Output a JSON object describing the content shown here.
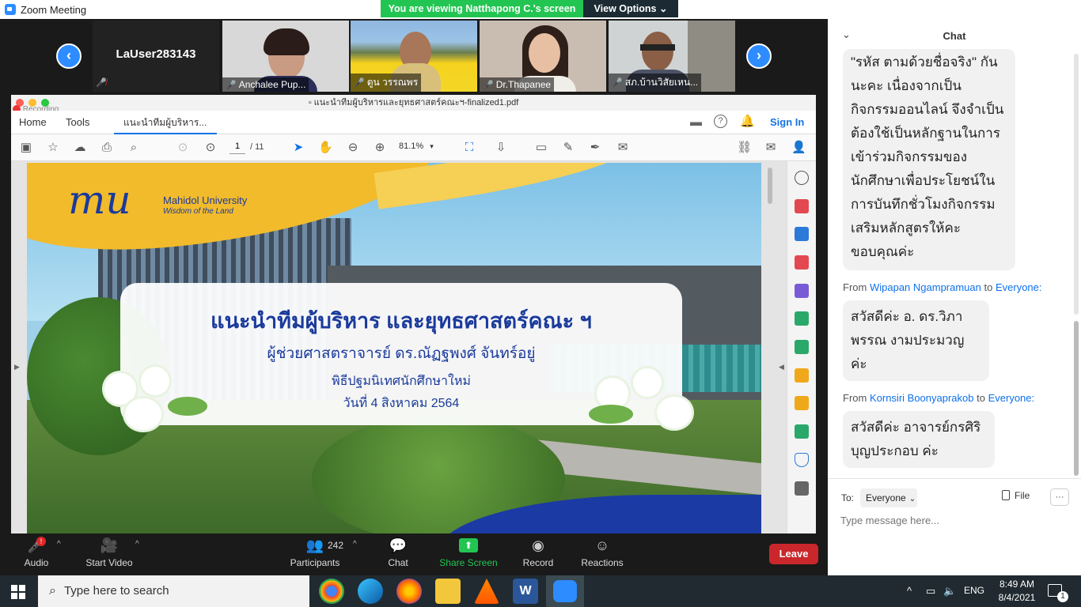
{
  "window": {
    "title": "Zoom Meeting",
    "minimize": "─",
    "restore": "❐",
    "close": "✕"
  },
  "banner": {
    "viewing": "You are viewing Natthapong C.'s screen",
    "view_options": "View Options"
  },
  "video_strip": {
    "self_name": "LaUser283143",
    "tiles": [
      {
        "name": "Anchalee Pup..."
      },
      {
        "name": "ตูน วรรณพร"
      },
      {
        "name": "Dr.Thapanee"
      },
      {
        "name": "สภ.บ้านวิสัยเหน..."
      }
    ],
    "recording": "Recording"
  },
  "acrobat": {
    "filename": "แนะนำทีมผู้บริหารและยุทธศาสตร์คณะฯ-finalized1.pdf",
    "tabs": {
      "home": "Home",
      "tools": "Tools",
      "doc": "แนะนำทีมผู้บริหาร..."
    },
    "sign_in": "Sign In",
    "page_current": "1",
    "page_total": "/ 11",
    "zoom": "81.1%",
    "page": {
      "university": "Mahidol University",
      "tagline": "Wisdom of the Land",
      "headline": "แนะนำทีมผู้บริหาร และยุทธศาสตร์คณะ ฯ",
      "presenter": "ผู้ช่วยศาสตราจารย์ ดร.ณัฏฐพงศ์ จันทร์อยู่",
      "event": "พิธีปฐมนิเทศนักศึกษาใหม่",
      "date": "วันที่ 4 สิงหาคม 2564"
    }
  },
  "toolbar": {
    "audio": "Audio",
    "start_video": "Start Video",
    "participants": "Participants",
    "participants_count": "242",
    "chat": "Chat",
    "share_screen": "Share Screen",
    "record": "Record",
    "reactions": "Reactions",
    "leave": "Leave",
    "audio_badge": "!"
  },
  "chat": {
    "title": "Chat",
    "messages": [
      {
        "text": "\"รหัส ตามด้วยชื่อจริง\" กันนะคะ เนื่องจากเป็นกิจกรรมออนไลน์ จึงจำเป็นต้องใช้เป็นหลักฐานในการเข้าร่วมกิจกรรมของนักศึกษาเพื่อประโยชน์ในการบันทึกชั่วโมงกิจกรรมเสริมหลักสูตรให้คะ ขอบคุณค่ะ"
      },
      {
        "from_label": "From",
        "sender": "Wipapan Ngampramuan",
        "to_label": "to",
        "recipient": "Everyone:",
        "text": "สวัสดีค่ะ อ. ดร.วิภาพรรณ งามประมวญ ค่ะ"
      },
      {
        "from_label": "From",
        "sender": "Kornsiri  Boonyaprakob",
        "to_label": "to",
        "recipient": "Everyone:",
        "text": "สวัสดีค่ะ อาจารย์กรศิริ บุญประกอบ ค่ะ"
      }
    ],
    "to_label": "To:",
    "to_value": "Everyone",
    "file_label": "File",
    "more": "···",
    "placeholder": "Type message here..."
  },
  "taskbar": {
    "search_placeholder": "Type here to search",
    "language": "ENG",
    "time": "8:49 AM",
    "date": "8/4/2021",
    "notification_count": "1"
  },
  "colors": {
    "zoom_blue": "#2d8cff",
    "share_green": "#23c552",
    "leave_red": "#c9272b",
    "headline_blue": "#1a3a9c",
    "mahidol_yellow": "#f2bb2c"
  }
}
